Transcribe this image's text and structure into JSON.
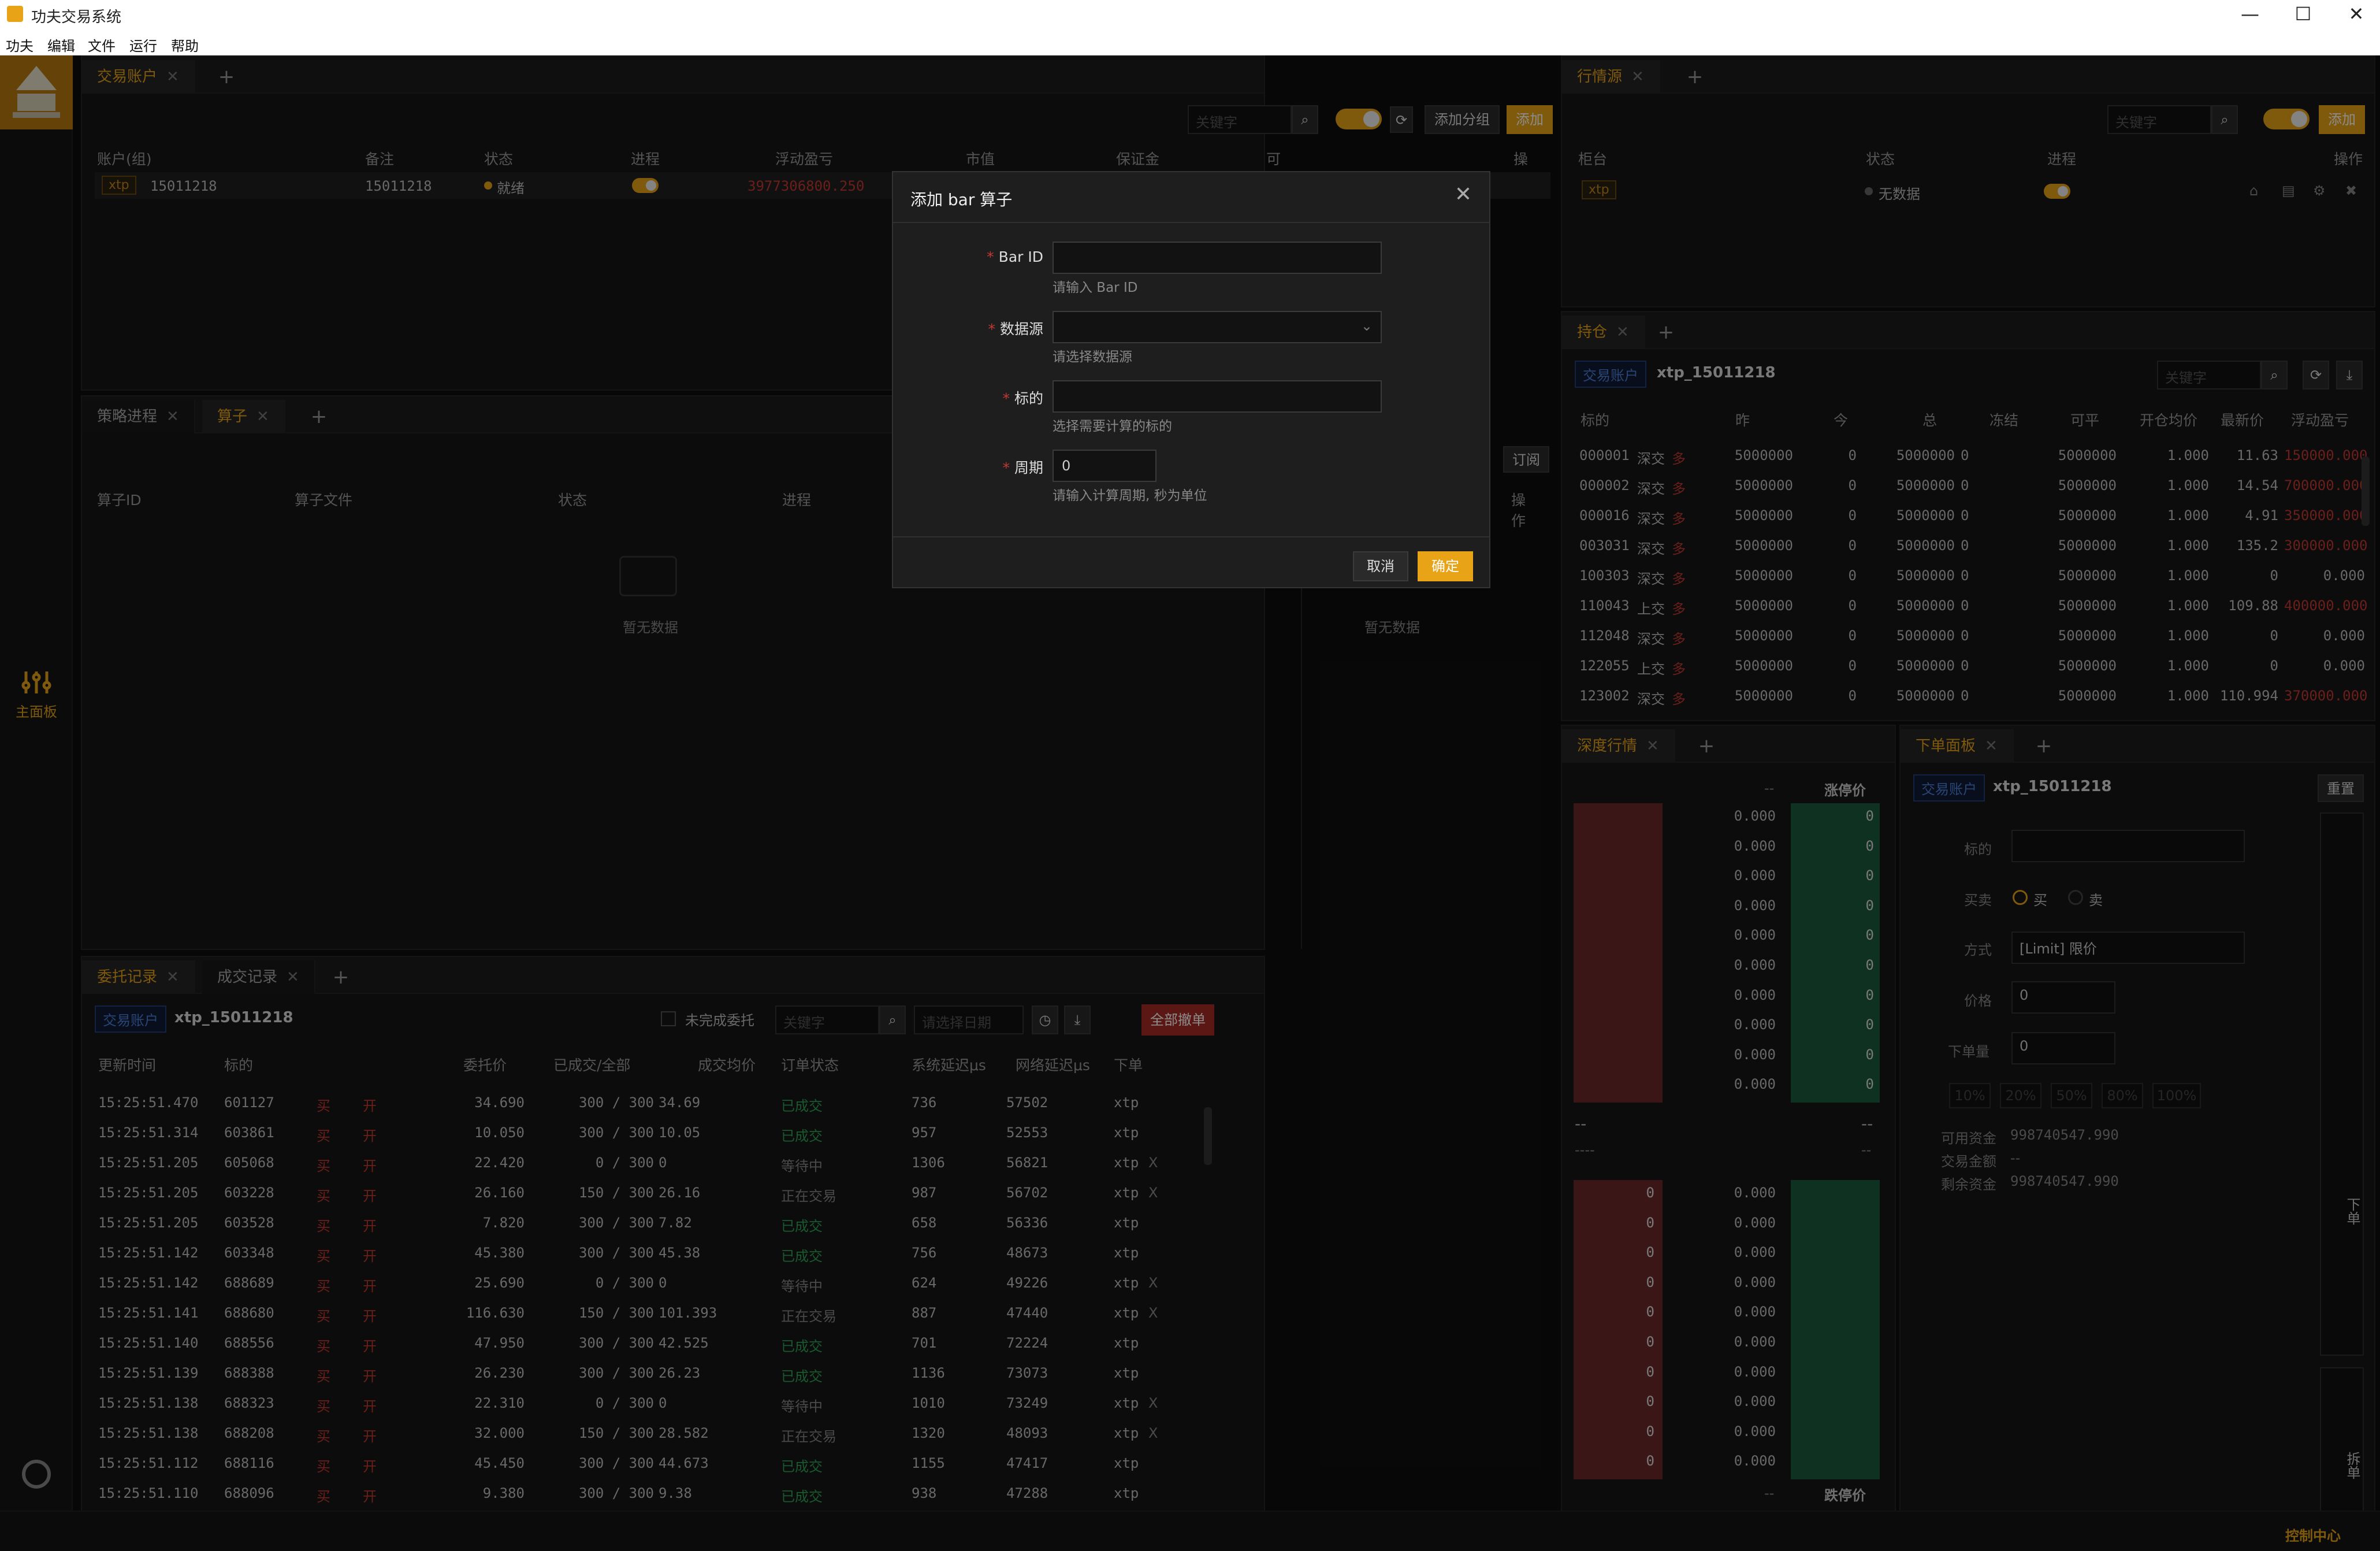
{
  "window": {
    "title": "功夫交易系统",
    "min": "—",
    "max": "☐",
    "close": "✕"
  },
  "menu": [
    "功夫",
    "编辑",
    "文件",
    "运行",
    "帮助"
  ],
  "rail": {
    "main_panel": "主面板",
    "main_icon": "sliders-icon"
  },
  "accounts": {
    "tabs": [
      "交易账户"
    ],
    "add": "+",
    "search_placeholder": "关键字",
    "btn_add_group": "添加分组",
    "btn_add": "添加",
    "headers": [
      "账户(组)",
      "备注",
      "状态",
      "进程",
      "浮动盈亏",
      "市值",
      "保证金",
      "可用资金",
      "操作"
    ],
    "rows": [
      {
        "tag": "xtp",
        "id": "15011218",
        "note": "15011218",
        "status": "就绪",
        "pnl": "3977306800.250"
      }
    ]
  },
  "strategy": {
    "tabs": [
      "策略进程",
      "算子"
    ],
    "add": "+",
    "subscribe": "订阅",
    "headers": [
      "算子ID",
      "算子文件",
      "状态",
      "进程",
      "操作"
    ],
    "empty": "暂无数据",
    "empty2": "暂无数据"
  },
  "orders": {
    "tabs": [
      "委托记录",
      "成交记录"
    ],
    "add": "+",
    "account_tag": "交易账户",
    "account": "xtp_15011218",
    "unfinished": "未完成委托",
    "search_placeholder": "关键字",
    "date_placeholder": "请选择日期",
    "cancel_all": "全部撤单",
    "headers": [
      "更新时间",
      "标的",
      "",
      "",
      "委托价",
      "已成交/全部",
      "成交均价",
      "订单状态",
      "系统延迟μs",
      "网络延迟μs",
      "下单"
    ],
    "rows": [
      [
        "15:25:51.470",
        "601127",
        "买",
        "开",
        "34.690",
        "300 / 300",
        "34.69",
        "已成交",
        "736",
        "57502",
        "xtp",
        ""
      ],
      [
        "15:25:51.314",
        "603861",
        "买",
        "开",
        "10.050",
        "300 / 300",
        "10.05",
        "已成交",
        "957",
        "52553",
        "xtp",
        ""
      ],
      [
        "15:25:51.205",
        "605068",
        "买",
        "开",
        "22.420",
        "0 / 300",
        "0",
        "等待中",
        "1306",
        "56821",
        "xtp",
        "X"
      ],
      [
        "15:25:51.205",
        "603228",
        "买",
        "开",
        "26.160",
        "150 / 300",
        "26.16",
        "正在交易",
        "987",
        "56702",
        "xtp",
        "X"
      ],
      [
        "15:25:51.205",
        "603528",
        "买",
        "开",
        "7.820",
        "300 / 300",
        "7.82",
        "已成交",
        "658",
        "56336",
        "xtp",
        ""
      ],
      [
        "15:25:51.142",
        "603348",
        "买",
        "开",
        "45.380",
        "300 / 300",
        "45.38",
        "已成交",
        "756",
        "48673",
        "xtp",
        ""
      ],
      [
        "15:25:51.142",
        "688689",
        "买",
        "开",
        "25.690",
        "0 / 300",
        "0",
        "等待中",
        "624",
        "49226",
        "xtp",
        "X"
      ],
      [
        "15:25:51.141",
        "688680",
        "买",
        "开",
        "116.630",
        "150 / 300",
        "101.393",
        "正在交易",
        "887",
        "47440",
        "xtp",
        "X"
      ],
      [
        "15:25:51.140",
        "688556",
        "买",
        "开",
        "47.950",
        "300 / 300",
        "42.525",
        "已成交",
        "701",
        "72224",
        "xtp",
        ""
      ],
      [
        "15:25:51.139",
        "688388",
        "买",
        "开",
        "26.230",
        "300 / 300",
        "26.23",
        "已成交",
        "1136",
        "73073",
        "xtp",
        ""
      ],
      [
        "15:25:51.138",
        "688323",
        "买",
        "开",
        "22.310",
        "0 / 300",
        "0",
        "等待中",
        "1010",
        "73249",
        "xtp",
        "X"
      ],
      [
        "15:25:51.138",
        "688208",
        "买",
        "开",
        "32.000",
        "150 / 300",
        "28.582",
        "正在交易",
        "1320",
        "48093",
        "xtp",
        "X"
      ],
      [
        "15:25:51.112",
        "688116",
        "买",
        "开",
        "45.450",
        "300 / 300",
        "44.673",
        "已成交",
        "1155",
        "47417",
        "xtp",
        ""
      ],
      [
        "15:25:51.110",
        "688096",
        "买",
        "开",
        "9.380",
        "300 / 300",
        "9.38",
        "已成交",
        "938",
        "47288",
        "xtp",
        ""
      ]
    ]
  },
  "market": {
    "tabs": [
      "行情源"
    ],
    "add": "+",
    "search_placeholder": "关键字",
    "btn_add": "添加",
    "headers": [
      "柜台",
      "状态",
      "进程",
      "操作"
    ],
    "rows": [
      {
        "tag": "xtp",
        "status": "无数据"
      }
    ]
  },
  "positions": {
    "tabs": [
      "持仓"
    ],
    "add": "+",
    "account_tag": "交易账户",
    "account": "xtp_15011218",
    "search_placeholder": "关键字",
    "headers": [
      "标的",
      "",
      "昨",
      "今",
      "总",
      "冻结",
      "可平",
      "开仓均价",
      "最新价",
      "浮动盈亏"
    ],
    "rows": [
      [
        "000001",
        "深交",
        "多",
        "5000000",
        "0",
        "5000000",
        "0",
        "5000000",
        "1.000",
        "11.63",
        "150000.000"
      ],
      [
        "000002",
        "深交",
        "多",
        "5000000",
        "0",
        "5000000",
        "0",
        "5000000",
        "1.000",
        "14.54",
        "700000.000"
      ],
      [
        "000016",
        "深交",
        "多",
        "5000000",
        "0",
        "5000000",
        "0",
        "5000000",
        "1.000",
        "4.91",
        "350000.000"
      ],
      [
        "003031",
        "深交",
        "多",
        "5000000",
        "0",
        "5000000",
        "0",
        "5000000",
        "1.000",
        "135.2",
        "300000.000"
      ],
      [
        "100303",
        "深交",
        "多",
        "5000000",
        "0",
        "5000000",
        "0",
        "5000000",
        "1.000",
        "0",
        "0.000"
      ],
      [
        "110043",
        "上交",
        "多",
        "5000000",
        "0",
        "5000000",
        "0",
        "5000000",
        "1.000",
        "109.88",
        "400000.000"
      ],
      [
        "112048",
        "深交",
        "多",
        "5000000",
        "0",
        "5000000",
        "0",
        "5000000",
        "1.000",
        "0",
        "0.000"
      ],
      [
        "122055",
        "上交",
        "多",
        "5000000",
        "0",
        "5000000",
        "0",
        "5000000",
        "1.000",
        "0",
        "0.000"
      ],
      [
        "123002",
        "深交",
        "多",
        "5000000",
        "0",
        "5000000",
        "0",
        "5000000",
        "1.000",
        "110.994",
        "370000.000"
      ]
    ]
  },
  "depth": {
    "tabs": [
      "深度行情"
    ],
    "add": "+",
    "dash": "--",
    "limit_up": "涨停价",
    "limit_down": "跌停价",
    "dash4": "----",
    "asks": [
      "0.000",
      "0.000",
      "0.000",
      "0.000",
      "0.000",
      "0.000",
      "0.000",
      "0.000",
      "0.000",
      "0.000"
    ],
    "ask_vol": [
      "0",
      "0",
      "0",
      "0",
      "0",
      "0",
      "0",
      "0",
      "0",
      "0"
    ],
    "bids": [
      "0.000",
      "0.000",
      "0.000",
      "0.000",
      "0.000",
      "0.000",
      "0.000",
      "0.000",
      "0.000",
      "0.000"
    ],
    "bid_vol": [
      "0",
      "0",
      "0",
      "0",
      "0",
      "0",
      "0",
      "0",
      "0",
      "0"
    ]
  },
  "order_panel": {
    "tabs": [
      "下单面板"
    ],
    "add": "+",
    "account_tag": "交易账户",
    "account": "xtp_15011218",
    "reset": "重置",
    "label_symbol": "标的",
    "label_side": "买卖",
    "buy": "买",
    "sell": "卖",
    "label_type": "方式",
    "type_value": "[Limit] 限价",
    "label_price": "价格",
    "price": "0",
    "label_qty": "下单量",
    "qty": "0",
    "pcts": [
      "10%",
      "20%",
      "50%",
      "80%",
      "100%"
    ],
    "avail_label": "可用资金",
    "avail": "998740547.990",
    "trade_amt_label": "交易金额",
    "trade_amt": "--",
    "remain_label": "剩余资金",
    "remain": "998740547.990",
    "place": "下单",
    "split": "拆单"
  },
  "modal": {
    "title": "添加 bar 算子",
    "close": "✕",
    "f1_label": "Bar ID",
    "f1_hint": "请输入 Bar ID",
    "f2_label": "数据源",
    "f2_hint": "请选择数据源",
    "f3_label": "标的",
    "f3_hint": "选择需要计算的标的",
    "f4_label": "周期",
    "f4_value": "0",
    "f4_hint": "请输入计算周期, 秒为单位",
    "cancel": "取消",
    "ok": "确定"
  },
  "status": {
    "control_center": "控制中心"
  }
}
